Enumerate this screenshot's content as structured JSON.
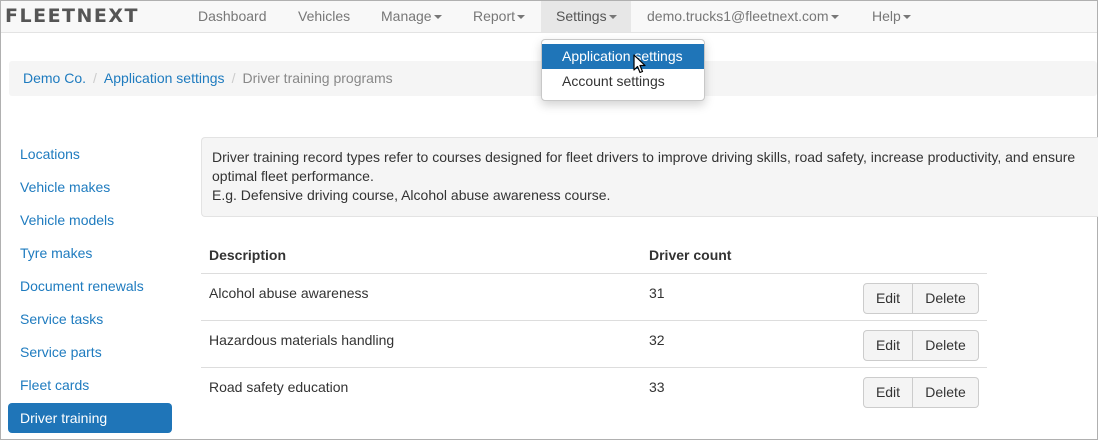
{
  "brand": "FLEETNEXT",
  "nav": {
    "dashboard": "Dashboard",
    "vehicles": "Vehicles",
    "manage": "Manage",
    "report": "Report",
    "settings": "Settings",
    "account": "demo.trucks1@fleetnext.com",
    "help": "Help"
  },
  "settings_menu": {
    "items": [
      "Application settings",
      "Account settings"
    ]
  },
  "breadcrumb": {
    "company": "Demo Co.",
    "section": "Application settings",
    "current": "Driver training programs",
    "separator": "/"
  },
  "sidebar": {
    "items": [
      "Locations",
      "Vehicle makes",
      "Vehicle models",
      "Tyre makes",
      "Document renewals",
      "Service tasks",
      "Service parts",
      "Fleet cards",
      "Driver training"
    ]
  },
  "info": {
    "line1": "Driver training record types refer to courses designed for fleet drivers to improve driving skills, road safety, increase productivity, and ensure",
    "line2": "optimal fleet performance.",
    "line3": "E.g. Defensive driving course, Alcohol abuse awareness course."
  },
  "table": {
    "headers": {
      "description": "Description",
      "driver_count": "Driver count"
    },
    "rows": [
      {
        "description": "Alcohol abuse awareness",
        "driver_count": "31"
      },
      {
        "description": "Hazardous materials handling",
        "driver_count": "32"
      },
      {
        "description": "Road safety education",
        "driver_count": "33"
      }
    ],
    "edit_label": "Edit",
    "delete_label": "Delete"
  },
  "colors": {
    "accent": "#1f75b8",
    "link": "#1e7bbf"
  }
}
